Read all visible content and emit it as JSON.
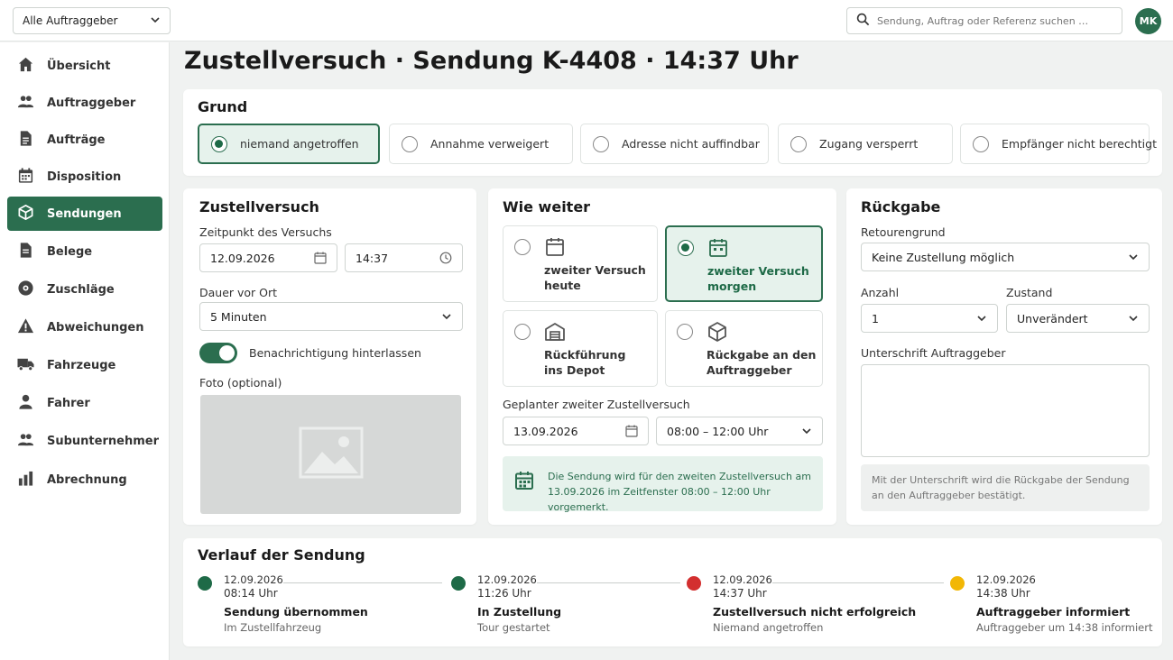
{
  "topbar": {
    "client_filter": "Alle Auftraggeber",
    "search_placeholder": "Sendung, Auftrag oder Referenz suchen …",
    "avatar_initials": "MK"
  },
  "sidebar": {
    "items": [
      {
        "label": "Übersicht",
        "icon": "home-icon",
        "active": false
      },
      {
        "label": "Auftraggeber",
        "icon": "people-icon",
        "active": false
      },
      {
        "label": "Aufträge",
        "icon": "document-icon",
        "active": false
      },
      {
        "label": "Disposition",
        "icon": "calendar-icon",
        "active": false
      },
      {
        "label": "Sendungen",
        "icon": "box-icon",
        "active": true
      },
      {
        "label": "Belege",
        "icon": "receipt-icon",
        "active": false
      },
      {
        "label": "Zuschläge",
        "icon": "disc-icon",
        "active": false
      },
      {
        "label": "Abweichungen",
        "icon": "warning-icon",
        "active": false
      },
      {
        "label": "Fahrzeuge",
        "icon": "truck-icon",
        "active": false
      },
      {
        "label": "Fahrer",
        "icon": "person-icon",
        "active": false
      },
      {
        "label": "Subunternehmer",
        "icon": "people-icon",
        "active": false
      },
      {
        "label": "Abrechnung",
        "icon": "bar-chart-icon",
        "active": false
      }
    ]
  },
  "page": {
    "title": "Zustellversuch · Sendung K-4408 · 14:37 Uhr"
  },
  "grund": {
    "title": "Grund",
    "options": [
      {
        "label": "niemand angetroffen",
        "selected": true
      },
      {
        "label": "Annahme verweigert",
        "selected": false
      },
      {
        "label": "Adresse nicht auffindbar",
        "selected": false
      },
      {
        "label": "Zugang versperrt",
        "selected": false
      },
      {
        "label": "Empfänger nicht berechtigt",
        "selected": false
      }
    ]
  },
  "zustellversuch": {
    "title": "Zustellversuch",
    "zeitpunkt_label": "Zeitpunkt des Versuchs",
    "date": "12.09.2026",
    "time": "14:37",
    "dauer_label": "Dauer vor Ort",
    "dauer_value": "5 Minuten",
    "notification_label": "Benachrichtigung hinterlassen",
    "notification_on": true,
    "foto_label": "Foto (optional)"
  },
  "wie_weiter": {
    "title": "Wie weiter",
    "options": [
      {
        "label": "zweiter Versuch\nheute",
        "icon": "calendar-icon",
        "selected": false
      },
      {
        "label": "zweiter Versuch\nmorgen",
        "icon": "calendar-icon",
        "selected": true
      },
      {
        "label": "Rückführung\nins Depot",
        "icon": "warehouse-icon",
        "selected": false
      },
      {
        "label": "Rückgabe an den\nAuftraggeber",
        "icon": "package-icon",
        "selected": false
      }
    ],
    "geplant_label": "Geplanter zweiter Zustellversuch",
    "geplant_date": "13.09.2026",
    "geplant_window": "08:00 – 12:00 Uhr",
    "info_text": "Die Sendung wird für den zweiten Zustellversuch am 13.09.2026 im Zeitfenster 08:00 – 12:00 Uhr vorgemerkt."
  },
  "rueckgabe": {
    "title": "Rückgabe",
    "retourengrund_label": "Retourengrund",
    "retourengrund_value": "Keine Zustellung möglich",
    "anzahl_label": "Anzahl",
    "anzahl_value": "1",
    "zustand_label": "Zustand",
    "zustand_value": "Unverändert",
    "unterschrift_label": "Unterschrift Auftraggeber",
    "unterschrift_note": "Mit der Unterschrift wird die Rückgabe der Sendung an den Auftraggeber bestätigt."
  },
  "verlauf": {
    "title": "Verlauf der Sendung",
    "events": [
      {
        "date": "12.09.2026",
        "time": "08:14 Uhr",
        "title": "Sendung übernommen",
        "sub": "Im Zustellfahrzeug",
        "color": "#1e6a47"
      },
      {
        "date": "12.09.2026",
        "time": "11:26 Uhr",
        "title": "In Zustellung",
        "sub": "Tour gestartet",
        "color": "#1e6a47"
      },
      {
        "date": "12.09.2026",
        "time": "14:37 Uhr",
        "title": "Zustellversuch nicht erfolgreich",
        "sub": "Niemand angetroffen",
        "color": "#d32f2f"
      },
      {
        "date": "12.09.2026",
        "time": "14:38 Uhr",
        "title": "Auftraggeber informiert",
        "sub": "Auftraggeber um 14:38 informiert",
        "color": "#f2b705"
      }
    ]
  }
}
